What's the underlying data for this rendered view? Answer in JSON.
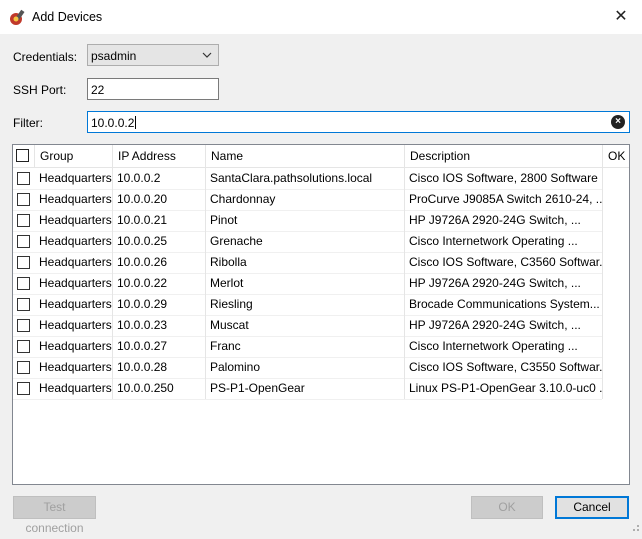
{
  "window": {
    "title": "Add Devices",
    "close_glyph": "✕"
  },
  "form": {
    "credentials_label": "Credentials:",
    "credentials_value": "psadmin",
    "ssh_port_label": "SSH Port:",
    "ssh_port_value": "22",
    "filter_label": "Filter:",
    "filter_value": "10.0.0.2"
  },
  "table": {
    "columns": [
      "Group",
      "IP Address",
      "Name",
      "Description",
      "OK"
    ],
    "rows": [
      {
        "group": "Headquarters",
        "ip": "10.0.0.2",
        "name": "SantaClara.pathsolutions.local",
        "description": "Cisco IOS Software, 2800 Software ...",
        "ok": ""
      },
      {
        "group": "Headquarters",
        "ip": "10.0.0.20",
        "name": "Chardonnay",
        "description": "ProCurve J9085A Switch 2610-24, ...",
        "ok": ""
      },
      {
        "group": "Headquarters",
        "ip": "10.0.0.21",
        "name": "Pinot",
        "description": "HP J9726A 2920-24G Switch, ...",
        "ok": ""
      },
      {
        "group": "Headquarters",
        "ip": "10.0.0.25",
        "name": "Grenache",
        "description": "Cisco Internetwork Operating ...",
        "ok": ""
      },
      {
        "group": "Headquarters",
        "ip": "10.0.0.26",
        "name": "Ribolla",
        "description": "Cisco IOS Software, C3560 Softwar...",
        "ok": ""
      },
      {
        "group": "Headquarters",
        "ip": "10.0.0.22",
        "name": "Merlot",
        "description": "HP J9726A 2920-24G Switch, ...",
        "ok": ""
      },
      {
        "group": "Headquarters",
        "ip": "10.0.0.29",
        "name": "Riesling",
        "description": "Brocade Communications System...",
        "ok": ""
      },
      {
        "group": "Headquarters",
        "ip": "10.0.0.23",
        "name": "Muscat",
        "description": "HP J9726A 2920-24G Switch, ...",
        "ok": ""
      },
      {
        "group": "Headquarters",
        "ip": "10.0.0.27",
        "name": "Franc",
        "description": "Cisco Internetwork Operating ...",
        "ok": ""
      },
      {
        "group": "Headquarters",
        "ip": "10.0.0.28",
        "name": "Palomino",
        "description": "Cisco IOS Software, C3550 Softwar...",
        "ok": ""
      },
      {
        "group": "Headquarters",
        "ip": "10.0.0.250",
        "name": "PS-P1-OpenGear",
        "description": "Linux PS-P1-OpenGear 3.10.0-uc0 ...",
        "ok": ""
      }
    ]
  },
  "buttons": {
    "test_connection": "Test connection",
    "ok": "OK",
    "cancel": "Cancel"
  },
  "colors": {
    "focus_border": "#0078d7",
    "disabled_text": "#a0a0a0"
  }
}
